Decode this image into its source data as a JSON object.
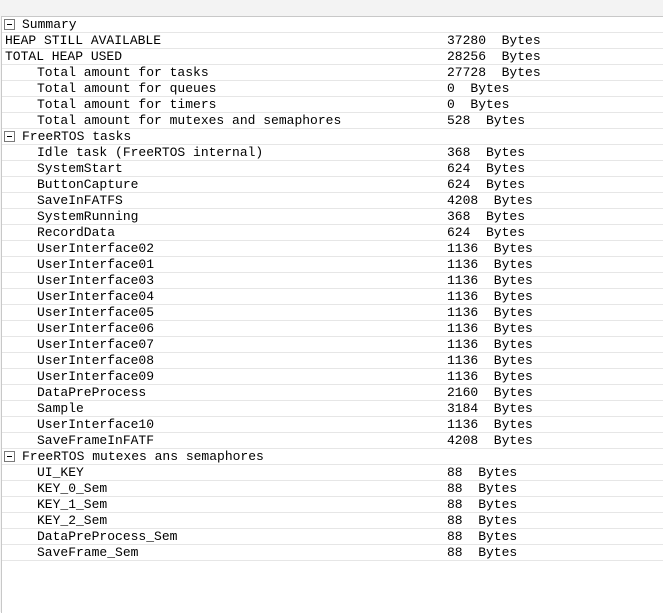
{
  "summary": {
    "label": "Summary",
    "heap_available": {
      "label": "HEAP STILL AVAILABLE",
      "value": "37280  Bytes"
    },
    "heap_used": {
      "label": "TOTAL HEAP USED",
      "value": "28256  Bytes"
    },
    "items": [
      {
        "label": "Total amount for tasks",
        "value": "27728  Bytes"
      },
      {
        "label": "Total amount for queues",
        "value": "0  Bytes"
      },
      {
        "label": "Total amount for timers",
        "value": "0  Bytes"
      },
      {
        "label": "Total amount for mutexes and semaphores",
        "value": "528  Bytes"
      }
    ]
  },
  "tasks": {
    "label": "FreeRTOS tasks",
    "items": [
      {
        "label": "Idle task (FreeRTOS internal)",
        "value": "368  Bytes"
      },
      {
        "label": "SystemStart",
        "value": "624  Bytes"
      },
      {
        "label": "ButtonCapture",
        "value": "624  Bytes"
      },
      {
        "label": "SaveInFATFS",
        "value": "4208  Bytes"
      },
      {
        "label": "SystemRunning",
        "value": "368  Bytes"
      },
      {
        "label": "RecordData",
        "value": "624  Bytes"
      },
      {
        "label": "UserInterface02",
        "value": "1136  Bytes"
      },
      {
        "label": "UserInterface01",
        "value": "1136  Bytes"
      },
      {
        "label": "UserInterface03",
        "value": "1136  Bytes"
      },
      {
        "label": "UserInterface04",
        "value": "1136  Bytes"
      },
      {
        "label": "UserInterface05",
        "value": "1136  Bytes"
      },
      {
        "label": "UserInterface06",
        "value": "1136  Bytes"
      },
      {
        "label": "UserInterface07",
        "value": "1136  Bytes"
      },
      {
        "label": "UserInterface08",
        "value": "1136  Bytes"
      },
      {
        "label": "UserInterface09",
        "value": "1136  Bytes"
      },
      {
        "label": "DataPreProcess",
        "value": "2160  Bytes"
      },
      {
        "label": "Sample",
        "value": "3184  Bytes"
      },
      {
        "label": "UserInterface10",
        "value": "1136  Bytes"
      },
      {
        "label": "SaveFrameInFATF",
        "value": "4208  Bytes"
      }
    ]
  },
  "mutexes": {
    "label": "FreeRTOS mutexes ans semaphores",
    "items": [
      {
        "label": "UI_KEY",
        "value": "88  Bytes"
      },
      {
        "label": "KEY_0_Sem",
        "value": "88  Bytes"
      },
      {
        "label": "KEY_1_Sem",
        "value": "88  Bytes"
      },
      {
        "label": "KEY_2_Sem",
        "value": "88  Bytes"
      },
      {
        "label": "DataPreProcess_Sem",
        "value": "88  Bytes"
      },
      {
        "label": "SaveFrame_Sem",
        "value": "88  Bytes"
      }
    ]
  }
}
